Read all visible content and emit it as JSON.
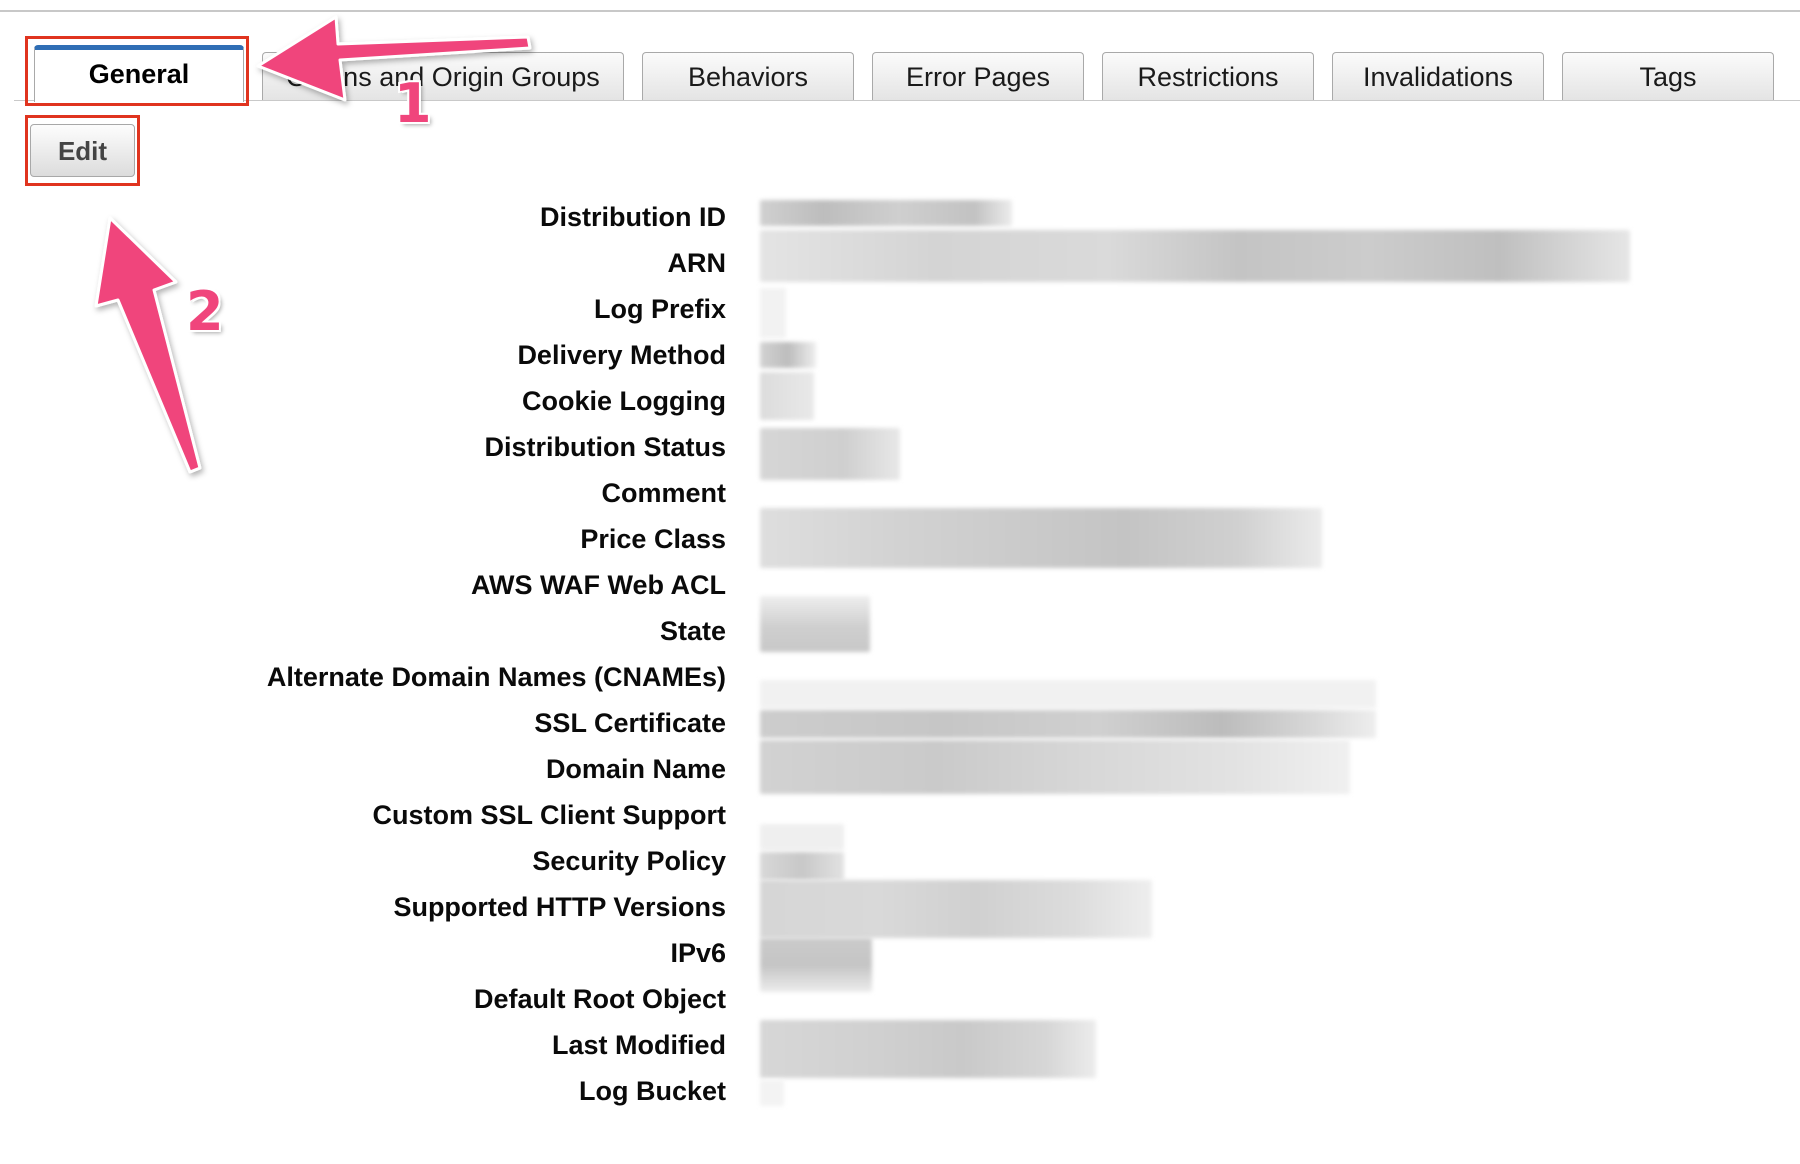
{
  "tabs": [
    {
      "label": "General",
      "active": true
    },
    {
      "label": "Origins and Origin Groups",
      "active": false
    },
    {
      "label": "Behaviors",
      "active": false
    },
    {
      "label": "Error Pages",
      "active": false
    },
    {
      "label": "Restrictions",
      "active": false
    },
    {
      "label": "Invalidations",
      "active": false
    },
    {
      "label": "Tags",
      "active": false
    }
  ],
  "toolbar": {
    "edit_label": "Edit"
  },
  "fields": [
    {
      "label": "Distribution ID",
      "value_state": "redacted"
    },
    {
      "label": "ARN",
      "value_state": "redacted"
    },
    {
      "label": "Log Prefix",
      "value_state": "redacted"
    },
    {
      "label": "Delivery Method",
      "value_state": "redacted"
    },
    {
      "label": "Cookie Logging",
      "value_state": "redacted"
    },
    {
      "label": "Distribution Status",
      "value_state": "redacted"
    },
    {
      "label": "Comment",
      "value_state": "redacted"
    },
    {
      "label": "Price Class",
      "value_state": "redacted"
    },
    {
      "label": "AWS WAF Web ACL",
      "value_state": "redacted"
    },
    {
      "label": "State",
      "value_state": "redacted"
    },
    {
      "label": "Alternate Domain Names (CNAMEs)",
      "value_state": "redacted"
    },
    {
      "label": "SSL Certificate",
      "value_state": "redacted"
    },
    {
      "label": "Domain Name",
      "value_state": "redacted"
    },
    {
      "label": "Custom SSL Client Support",
      "value_state": "redacted"
    },
    {
      "label": "Security Policy",
      "value_state": "redacted"
    },
    {
      "label": "Supported HTTP Versions",
      "value_state": "redacted"
    },
    {
      "label": "IPv6",
      "value_state": "redacted"
    },
    {
      "label": "Default Root Object",
      "value_state": "redacted"
    },
    {
      "label": "Last Modified",
      "value_state": "redacted"
    },
    {
      "label": "Log Bucket",
      "value_state": "redacted"
    }
  ],
  "annotations": {
    "step1": "1",
    "step2": "2",
    "arrow_color": "#f0457c",
    "highlight_color": "#e0341f"
  },
  "colors": {
    "active_tab_accent": "#2f6eb5",
    "redaction_gray": "#cfcfcf"
  }
}
